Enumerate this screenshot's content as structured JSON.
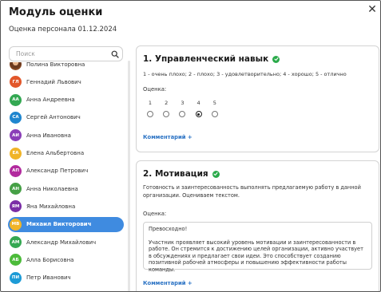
{
  "window": {
    "title": "Модуль оценки",
    "subtitle": "Оценка персонала 01.12.2024",
    "close_label": "✕"
  },
  "search": {
    "placeholder": "Поиск",
    "value": ""
  },
  "employees": [
    {
      "name": "Полина Викторовна",
      "initials": "",
      "avatar": "photo",
      "color": "#7a3e1e",
      "selected": false
    },
    {
      "name": "Геннадий Львович",
      "initials": "ГЛ",
      "avatar": "initials",
      "color": "#e2572b",
      "selected": false
    },
    {
      "name": "Анна Андреевна",
      "initials": "АА",
      "avatar": "initials",
      "color": "#33a852",
      "selected": false
    },
    {
      "name": "Сергей Антонович",
      "initials": "СА",
      "avatar": "initials",
      "color": "#1f86cf",
      "selected": false
    },
    {
      "name": "Анна Ивановна",
      "initials": "АИ",
      "avatar": "initials",
      "color": "#8a3fb8",
      "selected": false
    },
    {
      "name": "Елена Альбертовна",
      "initials": "ЕА",
      "avatar": "initials",
      "color": "#f0b428",
      "selected": false
    },
    {
      "name": "Александр Петрович",
      "initials": "АП",
      "avatar": "initials",
      "color": "#b22a9e",
      "selected": false
    },
    {
      "name": "Анна Николаевна",
      "initials": "АН",
      "avatar": "initials",
      "color": "#46a046",
      "selected": false
    },
    {
      "name": "Яна Михайловна",
      "initials": "ЯМ",
      "avatar": "initials",
      "color": "#7a2da6",
      "selected": false
    },
    {
      "name": "Михаил Викторович",
      "initials": "МВ",
      "avatar": "initials",
      "color": "#f0b428",
      "selected": true
    },
    {
      "name": "Александр Михайлович",
      "initials": "АМ",
      "avatar": "initials",
      "color": "#34a852",
      "selected": false
    },
    {
      "name": "Алла Борисовна",
      "initials": "АБ",
      "avatar": "initials",
      "color": "#4cbb3a",
      "selected": false
    },
    {
      "name": "Петр Иванович",
      "initials": "ПИ",
      "avatar": "initials",
      "color": "#1d9bd6",
      "selected": false
    }
  ],
  "sections": [
    {
      "title": "1. Управленческий навык",
      "scale": "1 - очень плохо; 2 - плохо; 3 - удовлетворительно; 4 - хорошо; 5 - отлично",
      "rating_label": "Оценка:",
      "options": [
        "1",
        "2",
        "3",
        "4",
        "5"
      ],
      "selected": 4,
      "comment_link": "Комментарий +"
    },
    {
      "title": "2. Мотивация",
      "description": "Готовность и заинтересованность выполнять предлагаемую работу в данной организации. Оцениваем текстом.",
      "rating_label": "Оценка:",
      "text_line1": "Превосходно!",
      "text_line2": "Участник проявляет высокий уровень мотивации и заинтересованности в работе. Он стремится к достижению целей организации, активно участвует в обсуждениях и предлагает свои идеи. Это способствует созданию позитивной рабочей атмосферы и повышению эффективности работы команды.",
      "comment_link": "Комментарий +"
    }
  ],
  "colors": {
    "accent": "#3f8be0",
    "link": "#2a72c4",
    "success": "#2aaa4a"
  }
}
